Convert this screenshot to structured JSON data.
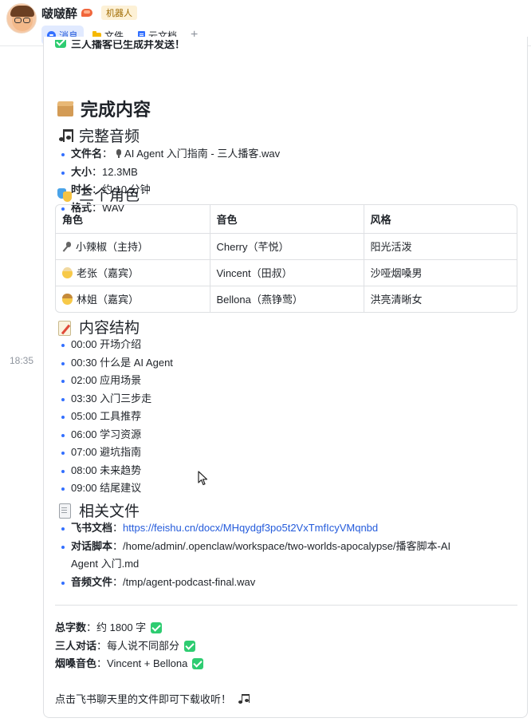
{
  "header": {
    "title": "啵啵醉",
    "bot_badge": "机器人",
    "tabs": [
      {
        "label": "消息",
        "icon": "message-icon",
        "active": true
      },
      {
        "label": "文件",
        "icon": "folder-icon",
        "active": false
      },
      {
        "label": "云文档",
        "icon": "doc-icon",
        "active": false
      }
    ],
    "add_tab": "+"
  },
  "timestamp": "18:35",
  "message": {
    "cut_line": "三人播客已生成并发送！",
    "heading": "完成内容",
    "audio_section": {
      "title": "完整音频",
      "items": [
        {
          "label": "文件名",
          "sep": "：",
          "value": "AI Agent 入门指南 - 三人播客.wav"
        },
        {
          "label": "大小",
          "sep": "：",
          "value": "12.3MB"
        },
        {
          "label": "时长",
          "sep": "：",
          "value": "约 10 分钟"
        },
        {
          "label": "格式",
          "sep": "：",
          "value": "WAV"
        }
      ]
    },
    "roles_section": {
      "title": "三个角色",
      "headers": [
        "角色",
        "音色",
        "风格"
      ],
      "rows": [
        {
          "role": "小辣椒（主持）",
          "voice": "Cherry（芊悦）",
          "style": "阳光活泼",
          "icon": "microphone-icon"
        },
        {
          "role": "老张（嘉宾）",
          "voice": "Vincent（田叔）",
          "style": "沙哑烟嗓男",
          "icon": "old-man-icon"
        },
        {
          "role": "林姐（嘉宾）",
          "voice": "Bellona（燕铮莺）",
          "style": "洪亮清晰女",
          "icon": "woman-icon"
        }
      ]
    },
    "structure_section": {
      "title": "内容结构",
      "items": [
        "00:00 开场介绍",
        "00:30 什么是 AI Agent",
        "02:00 应用场景",
        "03:30 入门三步走",
        "05:00 工具推荐",
        "06:00 学习资源",
        "07:00 避坑指南",
        "08:00 未来趋势",
        "09:00 结尾建议"
      ]
    },
    "files_section": {
      "title": "相关文件",
      "doc_label": "飞书文档",
      "doc_link": "https://feishu.cn/docx/MHqydgf3po5t2VxTmfIcyVMqnbd",
      "script_label": "对话脚本",
      "script_path_1": "/home/admin/.openclaw/workspace/two-worlds-apocalypse/播客脚本-AI",
      "script_path_2": "Agent 入门.md",
      "audio_label": "音频文件",
      "audio_path": "/tmp/agent-podcast-final.wav",
      "sep": "："
    },
    "summary": [
      {
        "label": "总字数",
        "sep": "：",
        "value": "约 1800 字"
      },
      {
        "label": "三人对话",
        "sep": "：",
        "value": "每人说不同部分"
      },
      {
        "label": "烟嗓音色",
        "sep": "：",
        "value": "Vincent + Bellona"
      }
    ],
    "footer": "点击飞书聊天里的文件即可下载收听！"
  },
  "colors": {
    "accent": "#3370ff",
    "link": "#245bdb",
    "check": "#2ecc71"
  }
}
